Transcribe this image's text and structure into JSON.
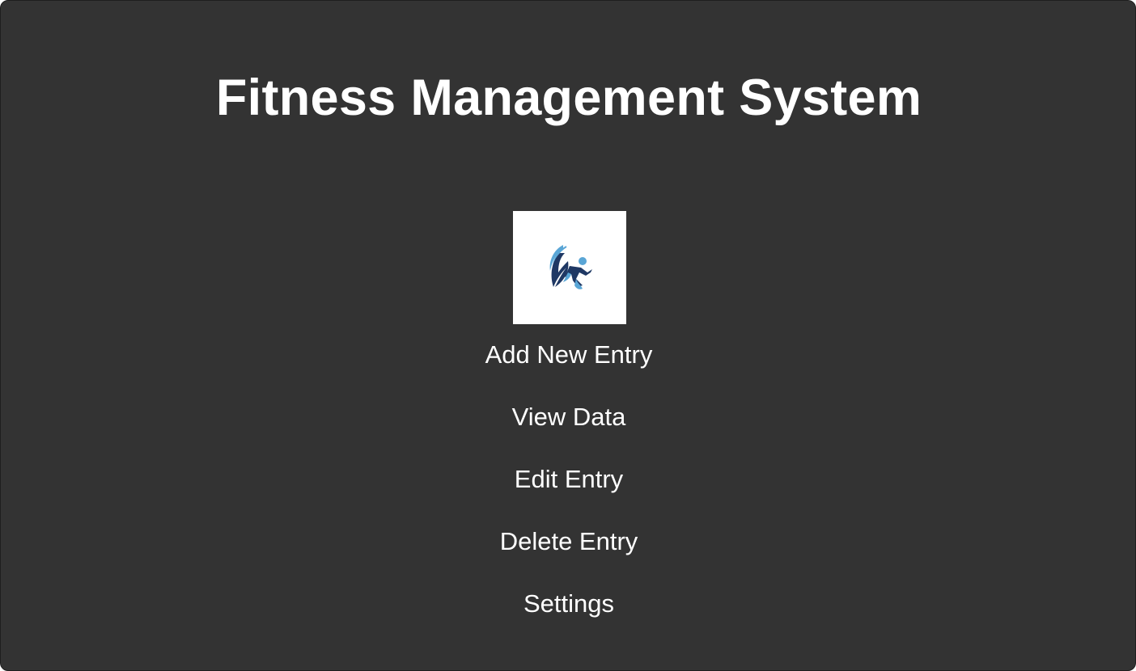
{
  "app": {
    "title": "Fitness Management System",
    "background_color": "#333333",
    "text_color": "#ffffff"
  },
  "logo": {
    "icon": "runner-logo-icon",
    "colors": {
      "navy": "#1f3864",
      "light_blue": "#5aa6d6"
    }
  },
  "menu": {
    "items": [
      {
        "label": "Add New Entry"
      },
      {
        "label": "View Data"
      },
      {
        "label": "Edit Entry"
      },
      {
        "label": "Delete Entry"
      },
      {
        "label": "Settings"
      }
    ]
  }
}
